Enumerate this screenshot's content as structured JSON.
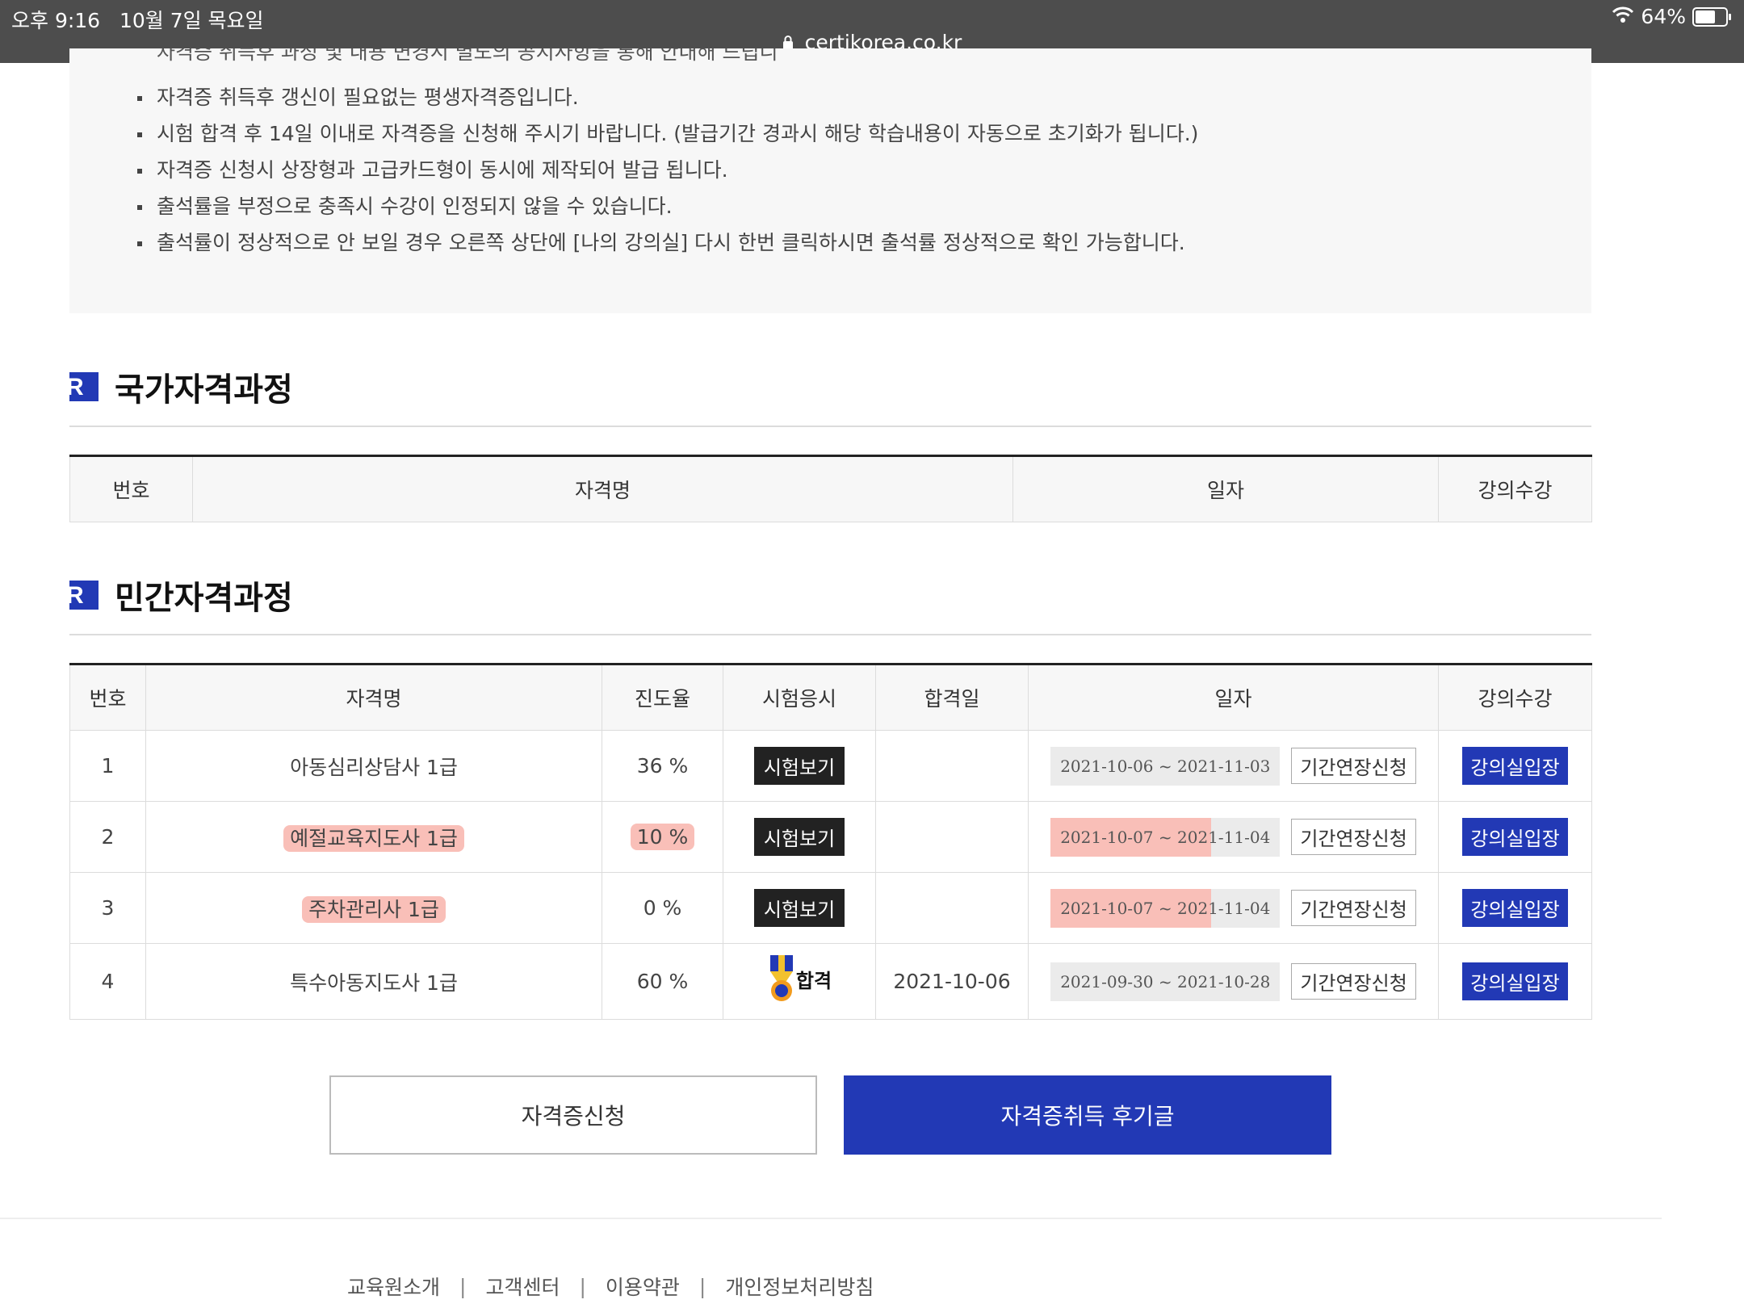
{
  "status_bar": {
    "time": "오후 9:16",
    "date": "10월 7일 목요일",
    "url": "certikorea.co.kr",
    "battery": "64%"
  },
  "notice": {
    "cut_line": "자격증 취득후 과정 및 내용 변경시 별도의 공지사항을 통해 안내해 드립니다.",
    "items": [
      "자격증 취득후 갱신이 필요없는 평생자격증입니다.",
      "시험 합격 후 14일 이내로 자격증을 신청해 주시기 바랍니다. (발급기간 경과시 해당 학습내용이 자동으로 초기화가 됩니다.)",
      "자격증 신청시 상장형과 고급카드형이 동시에 제작되어 발급 됩니다.",
      "출석률을 부정으로 충족시 수강이 인정되지 않을 수 있습니다.",
      "출석률이 정상적으로 안 보일 경우 오른쪽 상단에 [나의 강의실] 다시 한번 클릭하시면 출석률 정상적으로 확인 가능합니다."
    ]
  },
  "national": {
    "title": "국가자격과정",
    "headers": {
      "no": "번호",
      "name": "자격명",
      "date": "일자",
      "lecture": "강의수강"
    }
  },
  "private": {
    "title": "민간자격과정",
    "headers": {
      "no": "번호",
      "name": "자격명",
      "progress": "진도율",
      "exam": "시험응시",
      "pass_date": "합격일",
      "date": "일자",
      "lecture": "강의수강"
    },
    "exam_label": "시험보기",
    "pass_label": "합격",
    "extend_label": "기간연장신청",
    "enter_label": "강의실입장",
    "rows": [
      {
        "no": "1",
        "name": "아동심리상담사 1급",
        "progress": "36 %",
        "pass_date": "",
        "start": "2021-10-06",
        "end": "2021-11-03"
      },
      {
        "no": "2",
        "name": "예절교육지도사 1급",
        "progress": "10 %",
        "pass_date": "",
        "start": "2021-10-07",
        "end": "2021-11-04"
      },
      {
        "no": "3",
        "name": "주차관리사 1급",
        "progress": "0 %",
        "pass_date": "",
        "start": "2021-10-07",
        "end": "2021-11-04"
      },
      {
        "no": "4",
        "name": "특수아동지도사 1급",
        "progress": "60 %",
        "pass_date": "2021-10-06",
        "start": "2021-09-30",
        "end": "2021-10-28"
      }
    ]
  },
  "buttons": {
    "apply": "자격증신청",
    "review": "자격증취득 후기글"
  },
  "footer": {
    "links": [
      "교육원소개",
      "고객센터",
      "이용약관",
      "개인정보처리방침"
    ]
  },
  "colors": {
    "accent": "#2239b5",
    "highlight": "#f48a7d"
  }
}
